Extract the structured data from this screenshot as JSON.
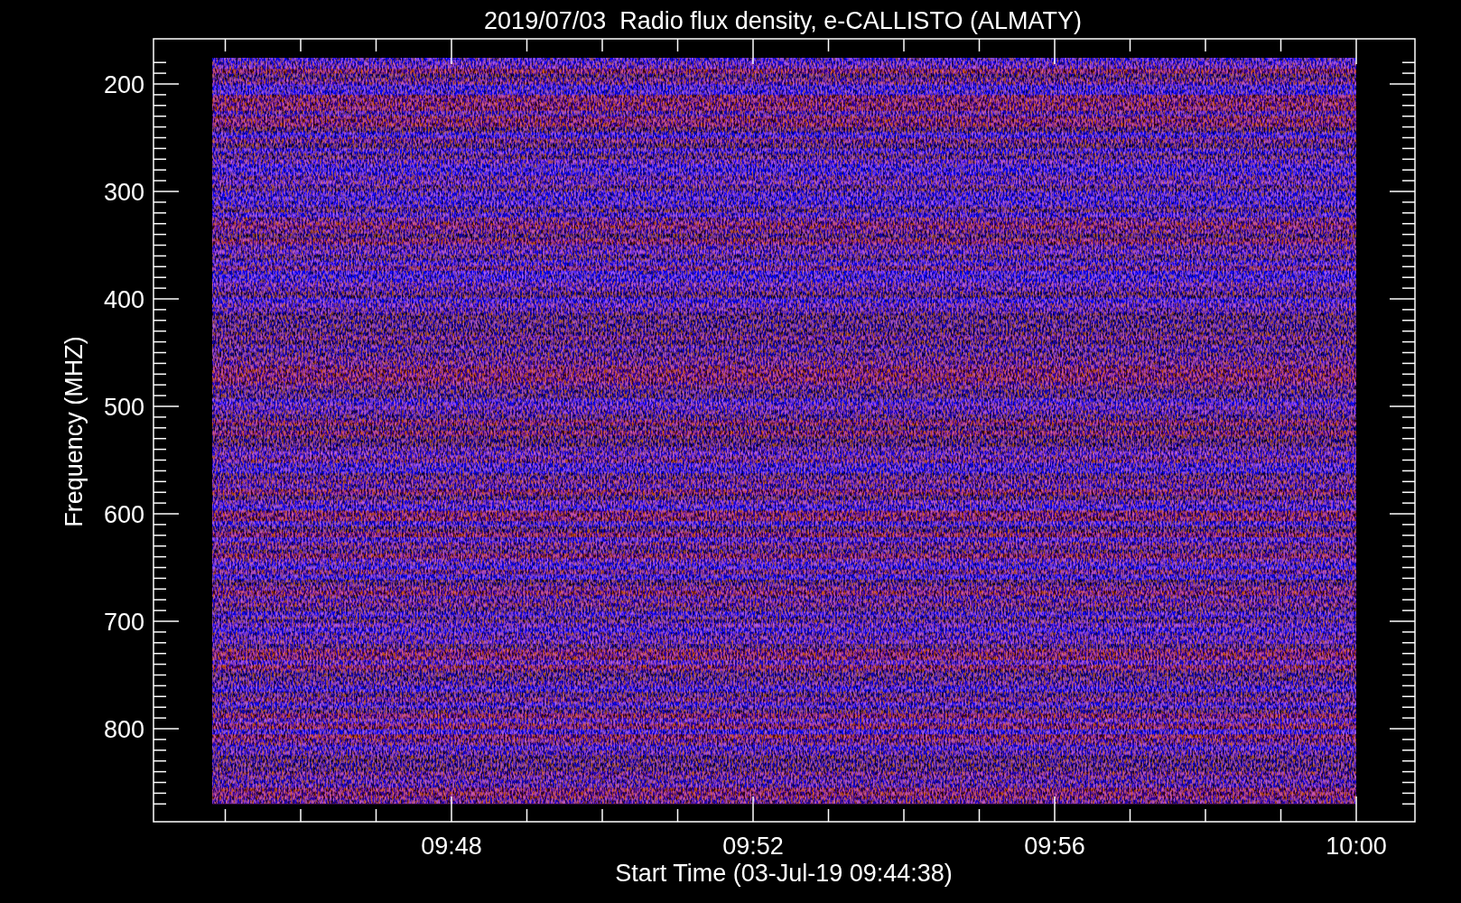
{
  "title": "2019/07/03  Radio flux density, e-CALLISTO (ALMATY)",
  "y_axis": {
    "label": "Frequency (MHZ)",
    "ticks": [
      "200",
      "300",
      "400",
      "500",
      "600",
      "700",
      "800"
    ]
  },
  "x_axis": {
    "label": "Start Time (03-Jul-19 09:44:38)",
    "ticks": [
      "09:48",
      "09:52",
      "09:56",
      "10:00"
    ]
  }
}
